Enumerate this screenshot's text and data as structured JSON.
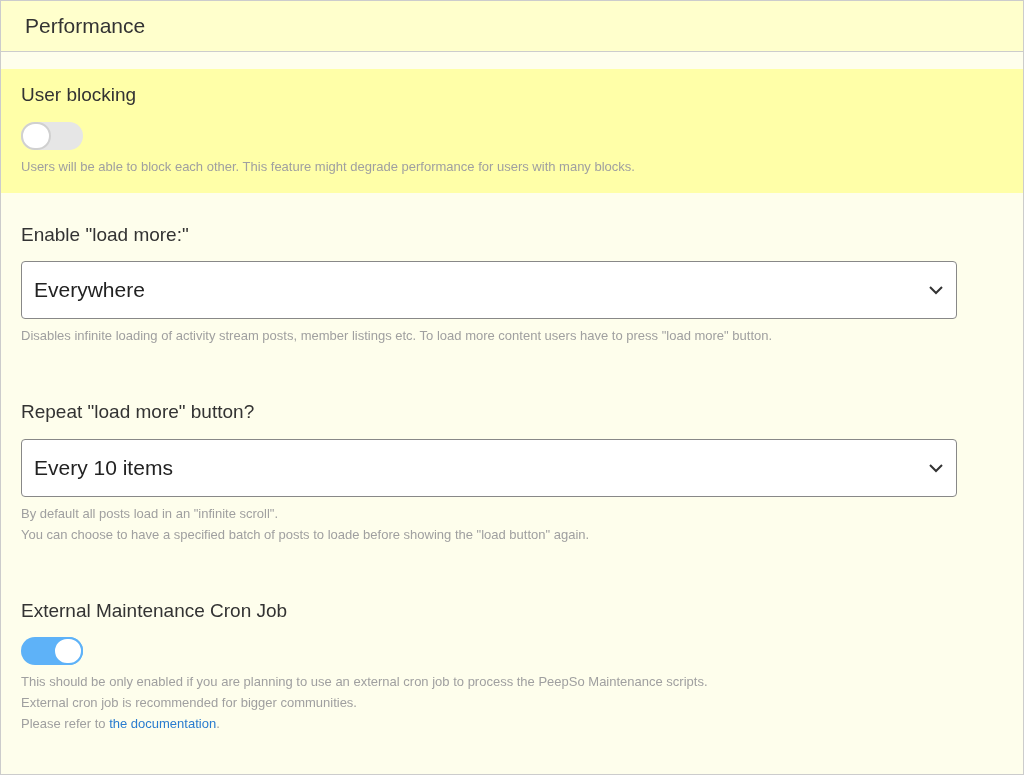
{
  "panel": {
    "title": "Performance"
  },
  "settings": [
    {
      "kind": "toggle",
      "label": "User blocking",
      "highlighted": true,
      "on": false,
      "help": [
        {
          "text": "Users will be able to block each other. This feature might degrade performance for users with many blocks."
        }
      ]
    },
    {
      "kind": "select",
      "label": "Enable \"load more:\"",
      "highlighted": false,
      "value": "Everywhere",
      "help": [
        {
          "text": "Disables infinite loading of activity stream posts, member listings etc. To load more content users have to press \"load more\" button."
        }
      ]
    },
    {
      "kind": "select",
      "label": "Repeat \"load more\" button?",
      "highlighted": false,
      "value": "Every 10 items",
      "help": [
        {
          "text": "By default all posts load in an \"infinite scroll\"."
        },
        {
          "text": "You can choose to have a specified batch of posts to loade before showing the \"load button\" again."
        }
      ]
    },
    {
      "kind": "toggle",
      "label": "External Maintenance Cron Job",
      "highlighted": false,
      "on": true,
      "help": [
        {
          "text": "This should be only enabled if you are planning to use an external cron job to process the PeepSo Maintenance scripts."
        },
        {
          "text": "External cron job is recommended for bigger communities."
        },
        {
          "text": "Please refer to ",
          "link": "the documentation",
          "after": "."
        }
      ]
    }
  ]
}
